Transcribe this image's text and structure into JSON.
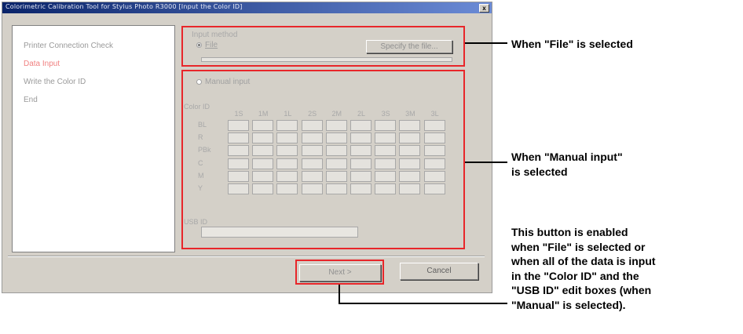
{
  "window": {
    "title": "Colorimetric Calibration Tool for Stylus Photo R3000 [Input the Color ID]",
    "close_glyph": "x"
  },
  "steps": [
    {
      "label": "Printer Connection Check",
      "active": false
    },
    {
      "label": "Data Input",
      "active": true
    },
    {
      "label": "Write the Color ID",
      "active": false
    },
    {
      "label": "End",
      "active": false
    }
  ],
  "input_method": {
    "group_label": "Input method",
    "file_radio_label": "File",
    "specify_button": "Specify the file...",
    "manual_radio_label": "Manual input"
  },
  "color_table": {
    "label": "Color ID",
    "columns": [
      "1S",
      "1M",
      "1L",
      "2S",
      "2M",
      "2L",
      "3S",
      "3M",
      "3L"
    ],
    "rows": [
      "BL",
      "R",
      "PBk",
      "C",
      "M",
      "Y"
    ]
  },
  "usb_id": {
    "label": "USB ID"
  },
  "buttons": {
    "next": "Next >",
    "cancel": "Cancel"
  },
  "annotations": {
    "file": "When \"File\" is selected",
    "manual_line1": "When \"Manual input\"",
    "manual_line2": "is selected",
    "note_lines": [
      "This button is enabled",
      "when \"File\" is selected or",
      "when all of the data is input",
      "in the \"Color ID\" and the",
      "\"USB ID\" edit boxes (when",
      "\"Manual\" is selected)."
    ]
  },
  "colors": {
    "highlight": "#e8262a",
    "dialog_bg": "#d4d0c8",
    "titlebar": "#0a246a"
  }
}
